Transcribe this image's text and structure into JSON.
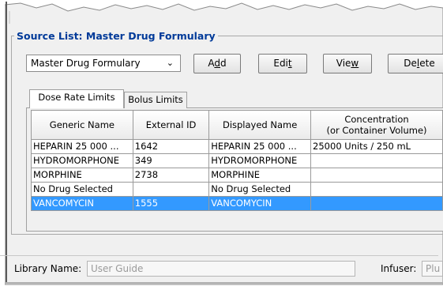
{
  "source_list": {
    "title": "Source List: Master Drug Formulary",
    "dropdown_value": "Master Drug Formulary",
    "buttons": {
      "add": {
        "pre": "A",
        "u": "d",
        "post": "d"
      },
      "edit": {
        "pre": "Edi",
        "u": "t",
        "post": ""
      },
      "view": {
        "pre": "Vie",
        "u": "w",
        "post": ""
      },
      "delete": {
        "pre": "De",
        "u": "l",
        "post": "ete"
      }
    }
  },
  "tabs": [
    {
      "label": "Dose Rate Limits",
      "active": true
    },
    {
      "label": "Bolus Limits",
      "active": false
    }
  ],
  "table": {
    "headers": {
      "generic": "Generic Name",
      "external": "External ID",
      "displayed": "Displayed Name",
      "concentration_line1": "Concentration",
      "concentration_line2": "(or Container Volume)"
    },
    "rows": [
      {
        "generic": "HEPARIN 25 000 ...",
        "external": "1642",
        "displayed": "HEPARIN 25 000 ...",
        "concentration": "25000 Units / 250 mL",
        "selected": false
      },
      {
        "generic": "HYDROMORPHONE",
        "external": "349",
        "displayed": "HYDROMORPHONE",
        "concentration": "",
        "selected": false
      },
      {
        "generic": "MORPHINE",
        "external": "2738",
        "displayed": "MORPHINE",
        "concentration": "",
        "selected": false
      },
      {
        "generic": "No Drug Selected",
        "external": "",
        "displayed": "No Drug Selected",
        "concentration": "",
        "selected": false
      },
      {
        "generic": "VANCOMYCIN",
        "external": "1555",
        "displayed": "VANCOMYCIN",
        "concentration": "",
        "selected": true
      }
    ]
  },
  "footer": {
    "library_label": "Library Name:",
    "library_value": "User Guide",
    "infuser_label": "Infuser:",
    "infuser_value": "Plu"
  },
  "colors": {
    "window_bg": "#f0f0f0",
    "title_color": "#003a99",
    "selection": "#3399ff"
  }
}
